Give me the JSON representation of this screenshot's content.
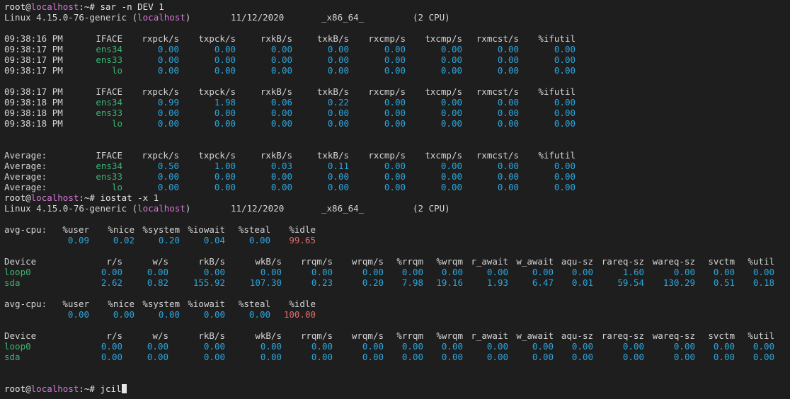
{
  "colors": {
    "background": "#1e1e1e",
    "text": "#d4d4d4",
    "hostname": "#d678d6",
    "interface": "#3cb371",
    "value": "#2aa6de",
    "idle_warning": "#e06c6c"
  },
  "prompt": {
    "user": "root",
    "at": "@",
    "host": "localhost",
    "suffix": ":~#"
  },
  "cmd1": " sar -n DEV 1",
  "cmd2": " iostat -x 1",
  "cmd3": " jcil",
  "sysinfo": {
    "prefix": "Linux 4.15.0-76-generic (",
    "host": "localhost",
    "suffix": ")",
    "date": "11/12/2020",
    "arch": "_x86_64_",
    "cpus": "(2 CPU)"
  },
  "sar_headers": [
    "IFACE",
    "rxpck/s",
    "txpck/s",
    "rxkB/s",
    "txkB/s",
    "rxcmp/s",
    "txcmp/s",
    "rxmcst/s",
    "%ifutil"
  ],
  "sar_blocks": [
    {
      "header_time": "09:38:16 PM",
      "rows": [
        {
          "time": "09:38:17 PM",
          "iface": "ens34",
          "vals": [
            "0.00",
            "0.00",
            "0.00",
            "0.00",
            "0.00",
            "0.00",
            "0.00",
            "0.00"
          ]
        },
        {
          "time": "09:38:17 PM",
          "iface": "ens33",
          "vals": [
            "0.00",
            "0.00",
            "0.00",
            "0.00",
            "0.00",
            "0.00",
            "0.00",
            "0.00"
          ]
        },
        {
          "time": "09:38:17 PM",
          "iface": "lo",
          "vals": [
            "0.00",
            "0.00",
            "0.00",
            "0.00",
            "0.00",
            "0.00",
            "0.00",
            "0.00"
          ]
        }
      ]
    },
    {
      "header_time": "09:38:17 PM",
      "rows": [
        {
          "time": "09:38:18 PM",
          "iface": "ens34",
          "vals": [
            "0.99",
            "1.98",
            "0.06",
            "0.22",
            "0.00",
            "0.00",
            "0.00",
            "0.00"
          ]
        },
        {
          "time": "09:38:18 PM",
          "iface": "ens33",
          "vals": [
            "0.00",
            "0.00",
            "0.00",
            "0.00",
            "0.00",
            "0.00",
            "0.00",
            "0.00"
          ]
        },
        {
          "time": "09:38:18 PM",
          "iface": "lo",
          "vals": [
            "0.00",
            "0.00",
            "0.00",
            "0.00",
            "0.00",
            "0.00",
            "0.00",
            "0.00"
          ]
        }
      ]
    },
    {
      "header_time": "Average:",
      "rows": [
        {
          "time": "Average:",
          "iface": "ens34",
          "vals": [
            "0.50",
            "1.00",
            "0.03",
            "0.11",
            "0.00",
            "0.00",
            "0.00",
            "0.00"
          ]
        },
        {
          "time": "Average:",
          "iface": "ens33",
          "vals": [
            "0.00",
            "0.00",
            "0.00",
            "0.00",
            "0.00",
            "0.00",
            "0.00",
            "0.00"
          ]
        },
        {
          "time": "Average:",
          "iface": "lo",
          "vals": [
            "0.00",
            "0.00",
            "0.00",
            "0.00",
            "0.00",
            "0.00",
            "0.00",
            "0.00"
          ]
        }
      ]
    }
  ],
  "cpu_label": "avg-cpu:",
  "cpu_headers": [
    "%user",
    "%nice",
    "%system",
    "%iowait",
    "%steal",
    "%idle"
  ],
  "dev_headers": [
    "Device",
    "r/s",
    "w/s",
    "rkB/s",
    "wkB/s",
    "rrqm/s",
    "wrqm/s",
    "%rrqm",
    "%wrqm",
    "r_await",
    "w_await",
    "aqu-sz",
    "rareq-sz",
    "wareq-sz",
    "svctm",
    "%util"
  ],
  "iostat_blocks": [
    {
      "cpu_vals": [
        "0.09",
        "0.02",
        "0.20",
        "0.04",
        "0.00",
        "99.65"
      ],
      "devices": [
        {
          "name": "loop0",
          "vals": [
            "0.00",
            "0.00",
            "0.00",
            "0.00",
            "0.00",
            "0.00",
            "0.00",
            "0.00",
            "0.00",
            "0.00",
            "0.00",
            "1.60",
            "0.00",
            "0.00",
            "0.00"
          ]
        },
        {
          "name": "sda",
          "vals": [
            "2.62",
            "0.82",
            "155.92",
            "107.30",
            "0.23",
            "0.20",
            "7.98",
            "19.16",
            "1.93",
            "6.47",
            "0.01",
            "59.54",
            "130.29",
            "0.51",
            "0.18"
          ]
        }
      ]
    },
    {
      "cpu_vals": [
        "0.00",
        "0.00",
        "0.00",
        "0.00",
        "0.00",
        "100.00"
      ],
      "devices": [
        {
          "name": "loop0",
          "vals": [
            "0.00",
            "0.00",
            "0.00",
            "0.00",
            "0.00",
            "0.00",
            "0.00",
            "0.00",
            "0.00",
            "0.00",
            "0.00",
            "0.00",
            "0.00",
            "0.00",
            "0.00"
          ]
        },
        {
          "name": "sda",
          "vals": [
            "0.00",
            "0.00",
            "0.00",
            "0.00",
            "0.00",
            "0.00",
            "0.00",
            "0.00",
            "0.00",
            "0.00",
            "0.00",
            "0.00",
            "0.00",
            "0.00",
            "0.00"
          ]
        }
      ]
    }
  ]
}
